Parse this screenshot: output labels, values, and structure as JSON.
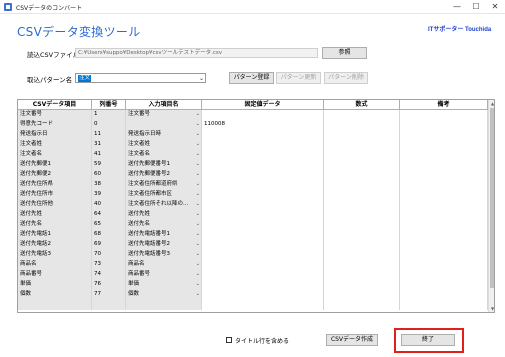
{
  "window": {
    "title": "CSVデータのコンバート",
    "minimize": "—",
    "maximize": "☐",
    "close": "✕"
  },
  "header": {
    "title": "CSVデータ変換ツール",
    "brand": "ITサポーター Touchida"
  },
  "file": {
    "label": "読込CSVファイル名",
    "path": "C:¥Users¥suppo¥Desktop¥csvツールテストデータ.csv",
    "browse": "参照"
  },
  "pattern": {
    "label": "取込パターン名",
    "selected": "注文",
    "register": "パターン登録",
    "update": "パターン更新",
    "delete": "パターン削除"
  },
  "grid": {
    "headers": [
      "CSVデータ項目",
      "列番号",
      "入力項目名",
      "固定値データ",
      "数式",
      "備考"
    ],
    "rows": [
      [
        "注文番号",
        "1",
        "注文番号",
        "",
        "",
        ""
      ],
      [
        "得意先コード",
        "0",
        "",
        "110008",
        "",
        ""
      ],
      [
        "発送指示日",
        "11",
        "発送指示日時",
        "",
        "",
        ""
      ],
      [
        "注文者姓",
        "31",
        "注文者姓",
        "",
        "",
        ""
      ],
      [
        "注文者名",
        "41",
        "注文者名",
        "",
        "",
        ""
      ],
      [
        "送付先郵便1",
        "59",
        "送付先郵便番号1",
        "",
        "",
        ""
      ],
      [
        "送付先郵便2",
        "60",
        "送付先郵便番号2",
        "",
        "",
        ""
      ],
      [
        "送付先住所県",
        "38",
        "注文者住所都道府県",
        "",
        "",
        ""
      ],
      [
        "送付先住所市",
        "39",
        "注文者住所都市区",
        "",
        "",
        ""
      ],
      [
        "送付先住所他",
        "40",
        "注文者住所それ以降の...",
        "",
        "",
        ""
      ],
      [
        "送付先姓",
        "64",
        "送付先姓",
        "",
        "",
        ""
      ],
      [
        "送付先名",
        "65",
        "送付先名",
        "",
        "",
        ""
      ],
      [
        "送付先電話1",
        "68",
        "送付先電話番号1",
        "",
        "",
        ""
      ],
      [
        "送付先電話2",
        "69",
        "送付先電話番号2",
        "",
        "",
        ""
      ],
      [
        "送付先電話3",
        "70",
        "送付先電話番号3",
        "",
        "",
        ""
      ],
      [
        "商品名",
        "73",
        "商品名",
        "",
        "",
        ""
      ],
      [
        "商品番号",
        "74",
        "商品番号",
        "",
        "",
        ""
      ],
      [
        "単価",
        "76",
        "単価",
        "",
        "",
        ""
      ],
      [
        "個数",
        "77",
        "個数",
        "",
        "",
        ""
      ],
      [
        "",
        "",
        "",
        "",
        "",
        ""
      ]
    ]
  },
  "footer": {
    "include_title": "タイトル行を含める",
    "include_title_checked": false,
    "csv_create": "CSVデータ作成",
    "exit": "終了"
  },
  "colors": {
    "title": "#2a6bd1",
    "brand": "#1d3fcf",
    "highlight": "#e0201c",
    "selection": "#0078d7"
  }
}
